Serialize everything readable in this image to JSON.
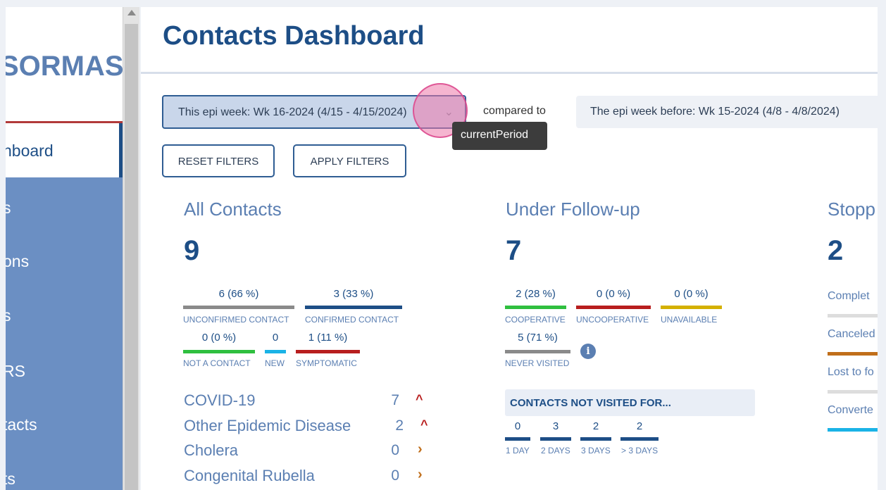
{
  "sidebar": {
    "logo": "SORMAS",
    "active_item": "hboard",
    "items": [
      "s",
      "ons",
      "s",
      "RS",
      "tacts",
      "ts"
    ]
  },
  "header": {
    "title": "Contacts Dashboard"
  },
  "filters": {
    "current_period": "This epi week: Wk 16-2024 (4/15 - 4/15/2024)",
    "compared_to": "compared to",
    "compare_period": "The epi week before: Wk 15-2024 (4/8 - 4/8/2024)",
    "tooltip": "currentPeriod",
    "reset_label": "RESET FILTERS",
    "apply_label": "APPLY FILTERS"
  },
  "all_contacts": {
    "title": "All Contacts",
    "count": "9",
    "stats": [
      {
        "value": "6 (66 %)",
        "label": "UNCONFIRMED CONTACT",
        "color": "#8a8a8a"
      },
      {
        "value": "3 (33 %)",
        "label": "CONFIRMED CONTACT",
        "color": "#1d4e86"
      },
      {
        "value": "0 (0 %)",
        "label": "NOT A CONTACT",
        "color": "#2fbf3f"
      },
      {
        "value": "0",
        "label": "NEW",
        "color": "#1ab3e6"
      },
      {
        "value": "1 (11 %)",
        "label": "SYMPTOMATIC",
        "color": "#b81e1e"
      }
    ],
    "diseases": [
      {
        "name": "COVID-19",
        "value": "7",
        "trend": "up"
      },
      {
        "name": "Other Epidemic Disease",
        "value": "2",
        "trend": "up"
      },
      {
        "name": "Cholera",
        "value": "0",
        "trend": "flat"
      },
      {
        "name": "Congenital Rubella",
        "value": "0",
        "trend": "flat"
      }
    ]
  },
  "follow_up": {
    "title": "Under Follow-up",
    "count": "7",
    "stats": [
      {
        "value": "2 (28 %)",
        "label": "COOPERATIVE",
        "color": "#2fbf3f"
      },
      {
        "value": "0 (0 %)",
        "label": "UNCOOPERATIVE",
        "color": "#b81e1e"
      },
      {
        "value": "0 (0 %)",
        "label": "UNAVAILABLE",
        "color": "#d4b000"
      },
      {
        "value": "5 (71 %)",
        "label": "NEVER VISITED",
        "color": "#8a8a8a"
      }
    ],
    "info_icon": "info-icon",
    "not_visited_title": "CONTACTS NOT VISITED FOR...",
    "not_visited": [
      {
        "value": "0",
        "label": "1 DAY"
      },
      {
        "value": "3",
        "label": "2 DAYS"
      },
      {
        "value": "2",
        "label": "3 DAYS"
      },
      {
        "value": "2",
        "label": "> 3 DAYS"
      }
    ]
  },
  "stopped": {
    "title": "Stopp",
    "count": "2",
    "items": [
      {
        "label": "Complet",
        "color": "#dddddd"
      },
      {
        "label": "Canceled",
        "color": "#c06e1a"
      },
      {
        "label": "Lost to fo",
        "color": "#dddddd"
      },
      {
        "label": "Converte",
        "color": "#1ab3e6"
      }
    ]
  }
}
